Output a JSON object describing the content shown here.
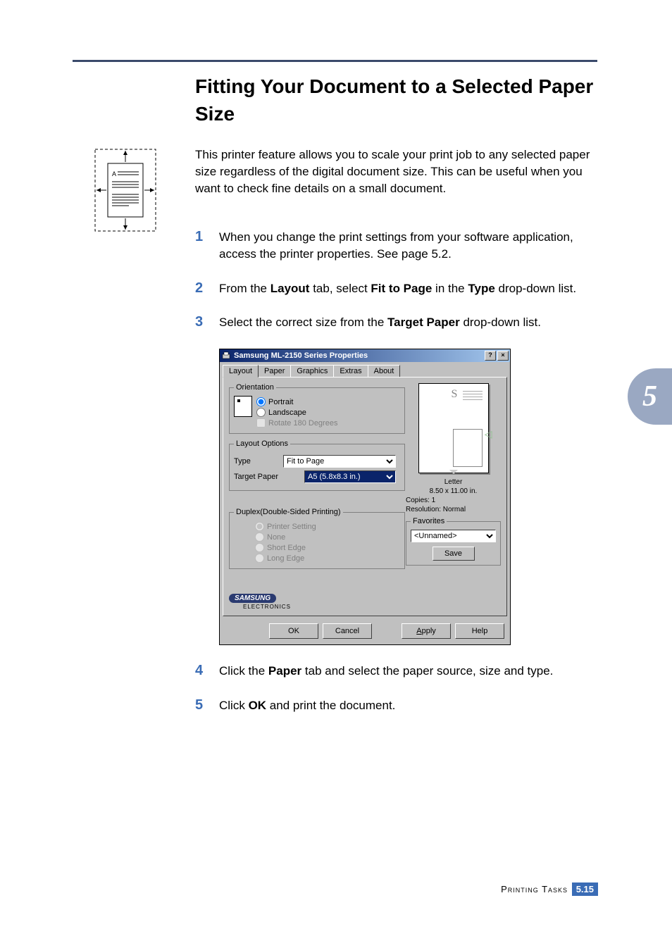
{
  "heading": "Fitting Your Document to a Selected Paper Size",
  "intro": "This printer feature allows you to scale your print job to any selected paper size regardless of the digital document size. This can be useful when you want to check fine details on a small document.",
  "steps": {
    "s1_a": "When you change the print settings from your software application, access the printer properties. See ",
    "s1_link": "page 5.2",
    "s1_b": ".",
    "s2_a": "From the ",
    "s2_b": "Layout",
    "s2_c": " tab, select ",
    "s2_d": "Fit to Page",
    "s2_e": " in the ",
    "s2_f": "Type",
    "s2_g": " drop-down list.",
    "s3_a": "Select the correct size from the ",
    "s3_b": "Target Paper",
    "s3_c": " drop-down list.",
    "s4_a": "Click the ",
    "s4_b": "Paper",
    "s4_c": " tab and select the paper source, size and type.",
    "s5_a": "Click ",
    "s5_b": "OK",
    "s5_c": " and print the document."
  },
  "numbers": {
    "n1": "1",
    "n2": "2",
    "n3": "3",
    "n4": "4",
    "n5": "5"
  },
  "dialog": {
    "title": "Samsung ML-2150 Series Properties",
    "help_btn": "?",
    "close_btn": "×",
    "tabs": {
      "layout": "Layout",
      "paper": "Paper",
      "graphics": "Graphics",
      "extras": "Extras",
      "about": "About"
    },
    "orientation": {
      "legend": "Orientation",
      "portrait": "Portrait",
      "landscape": "Landscape",
      "rotate": "Rotate 180 Degrees"
    },
    "layout_options": {
      "legend": "Layout Options",
      "type_label": "Type",
      "type_value": "Fit to Page",
      "target_label": "Target Paper",
      "target_value": "A5 (5.8x8.3 in.)"
    },
    "duplex": {
      "legend": "Duplex(Double-Sided Printing)",
      "printer_setting": "Printer Setting",
      "none": "None",
      "short_edge": "Short Edge",
      "long_edge": "Long Edge"
    },
    "preview": {
      "paper_name": "Letter",
      "paper_dim": "8.50 x 11.00 in.",
      "copies": "Copies: 1",
      "resolution": "Resolution: Normal"
    },
    "favorites": {
      "legend": "Favorites",
      "value": "<Unnamed>",
      "save": "Save"
    },
    "logo_brand": "SAMSUNG",
    "logo_sub": "ELECTRONICS",
    "buttons": {
      "ok": "OK",
      "cancel": "Cancel",
      "apply": "Apply",
      "help": "Help"
    }
  },
  "thumb": "5",
  "footer": {
    "label": "Printing Tasks",
    "chapter": "5.",
    "page": "15"
  },
  "diagram_letter": "A"
}
